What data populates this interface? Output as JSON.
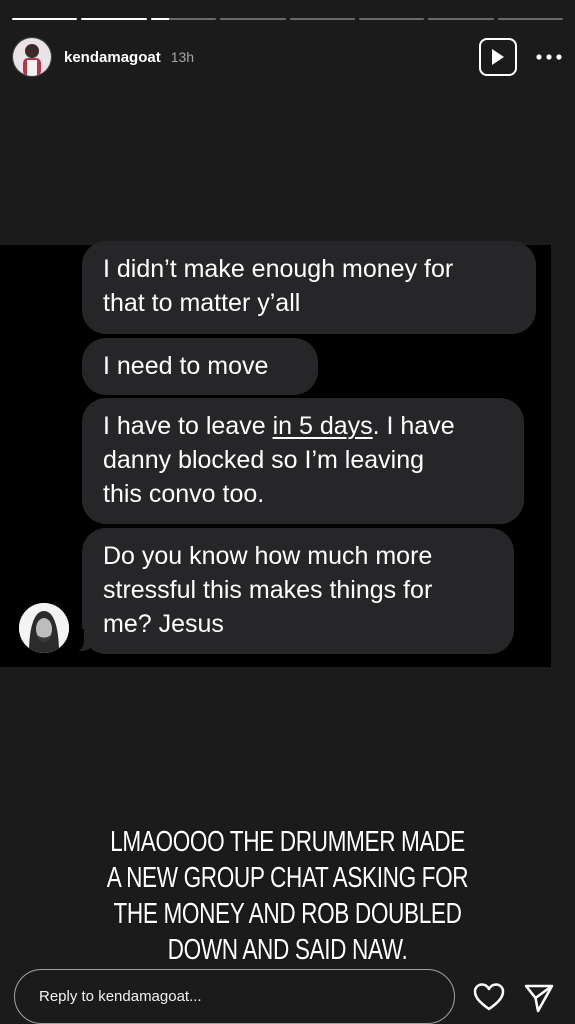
{
  "progress": {
    "segments": 8,
    "filled": [
      1,
      1,
      0.28,
      0,
      0,
      0,
      0,
      0
    ]
  },
  "header": {
    "username": "kendamagoat",
    "time": "13h"
  },
  "messages": {
    "m1": {
      "line1": "I didn’t make enough money for",
      "line2": "that to matter y’all"
    },
    "m2": {
      "line1": "I need to move"
    },
    "m3": {
      "pre": "I have to leave ",
      "underlined": "in 5 days",
      "post": ". I have",
      "line2": "danny blocked so I’m leaving",
      "line3": "this convo too."
    },
    "m4": {
      "line1": "Do you know how much more",
      "line2": "stressful this makes things for",
      "line3": "me? Jesus"
    }
  },
  "caption": {
    "line1": "LMAOOOO THE DRUMMER MADE",
    "line2": "A NEW GROUP CHAT ASKING FOR",
    "line3": "THE MONEY AND ROB DOUBLED",
    "line4": "DOWN AND SAID NAW."
  },
  "reply": {
    "placeholder": "Reply to kendamagoat..."
  },
  "icons": {
    "play": "play-icon",
    "more": "more-horizontal-icon",
    "heart": "heart-icon",
    "send": "send-icon"
  }
}
